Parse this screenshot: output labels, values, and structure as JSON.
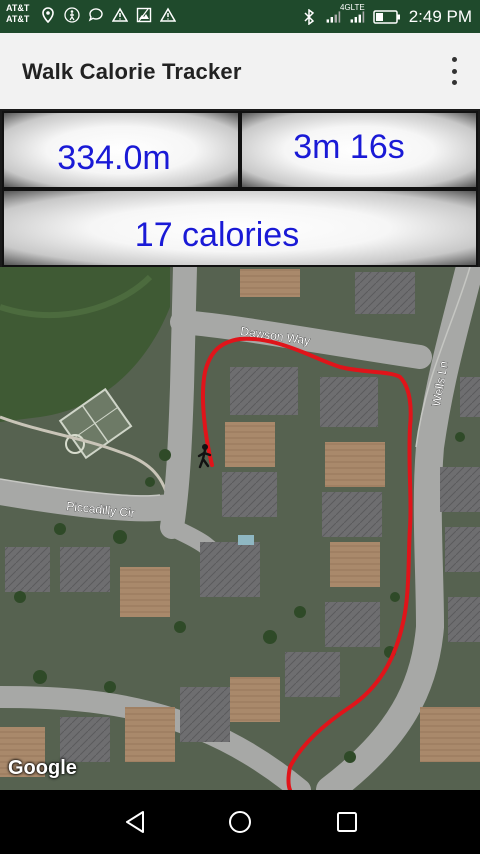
{
  "status_bar": {
    "carrier_line1": "AT&T",
    "carrier_line2": "AT&T",
    "network_label": "4GLTE",
    "time": "2:49 PM",
    "left_icons": [
      "location-icon",
      "activity-icon",
      "chat-icon",
      "warning-icon",
      "image-icon",
      "warning-icon"
    ],
    "right_icons": [
      "bluetooth-icon",
      "signal-icon",
      "lte-signal-icon",
      "battery-icon"
    ]
  },
  "app_bar": {
    "title": "Walk Calorie Tracker",
    "menu_icon": "overflow-menu-icon"
  },
  "stats": {
    "distance": "334.0m",
    "duration": "3m 16s",
    "calories": "17 calories",
    "text_color": "#1a1ad6"
  },
  "map": {
    "streets": [
      "Dawson Way",
      "Wells Ln",
      "Piccadilly Cir"
    ],
    "attribution": "Google",
    "route_color": "#e0141a",
    "walker_icon": "walking-person-icon"
  },
  "nav_bar": {
    "buttons": [
      "back-icon",
      "home-icon",
      "recents-icon"
    ]
  }
}
